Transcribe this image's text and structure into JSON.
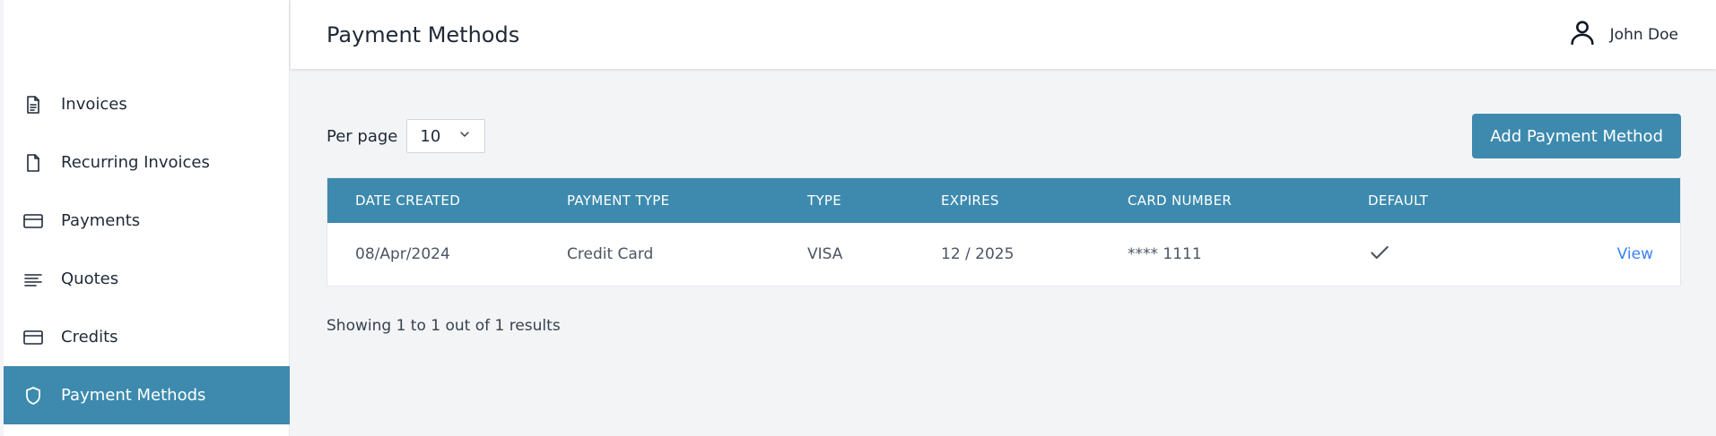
{
  "sidebar": {
    "items": [
      {
        "label": "Invoices",
        "icon": "document-text-icon"
      },
      {
        "label": "Recurring Invoices",
        "icon": "document-icon"
      },
      {
        "label": "Payments",
        "icon": "credit-card-icon"
      },
      {
        "label": "Quotes",
        "icon": "align-left-icon"
      },
      {
        "label": "Credits",
        "icon": "credit-card-icon"
      },
      {
        "label": "Payment Methods",
        "icon": "shield-icon",
        "active": true
      }
    ]
  },
  "header": {
    "title": "Payment Methods",
    "user_name": "John Doe"
  },
  "toolbar": {
    "per_page_label": "Per page",
    "per_page_value": "10",
    "add_button_label": "Add Payment Method"
  },
  "table": {
    "columns": [
      "DATE CREATED",
      "PAYMENT TYPE",
      "TYPE",
      "EXPIRES",
      "CARD NUMBER",
      "DEFAULT"
    ],
    "rows": [
      {
        "date_created": "08/Apr/2024",
        "payment_type": "Credit Card",
        "type": "VISA",
        "expires": "12 / 2025",
        "card_number": "**** 1111",
        "default": true,
        "action": "View"
      }
    ]
  },
  "footer": {
    "summary": "Showing 1 to 1 out of 1 results"
  },
  "colors": {
    "accent": "#3d8aae",
    "link": "#3b82f6",
    "background": "#f3f4f6"
  }
}
